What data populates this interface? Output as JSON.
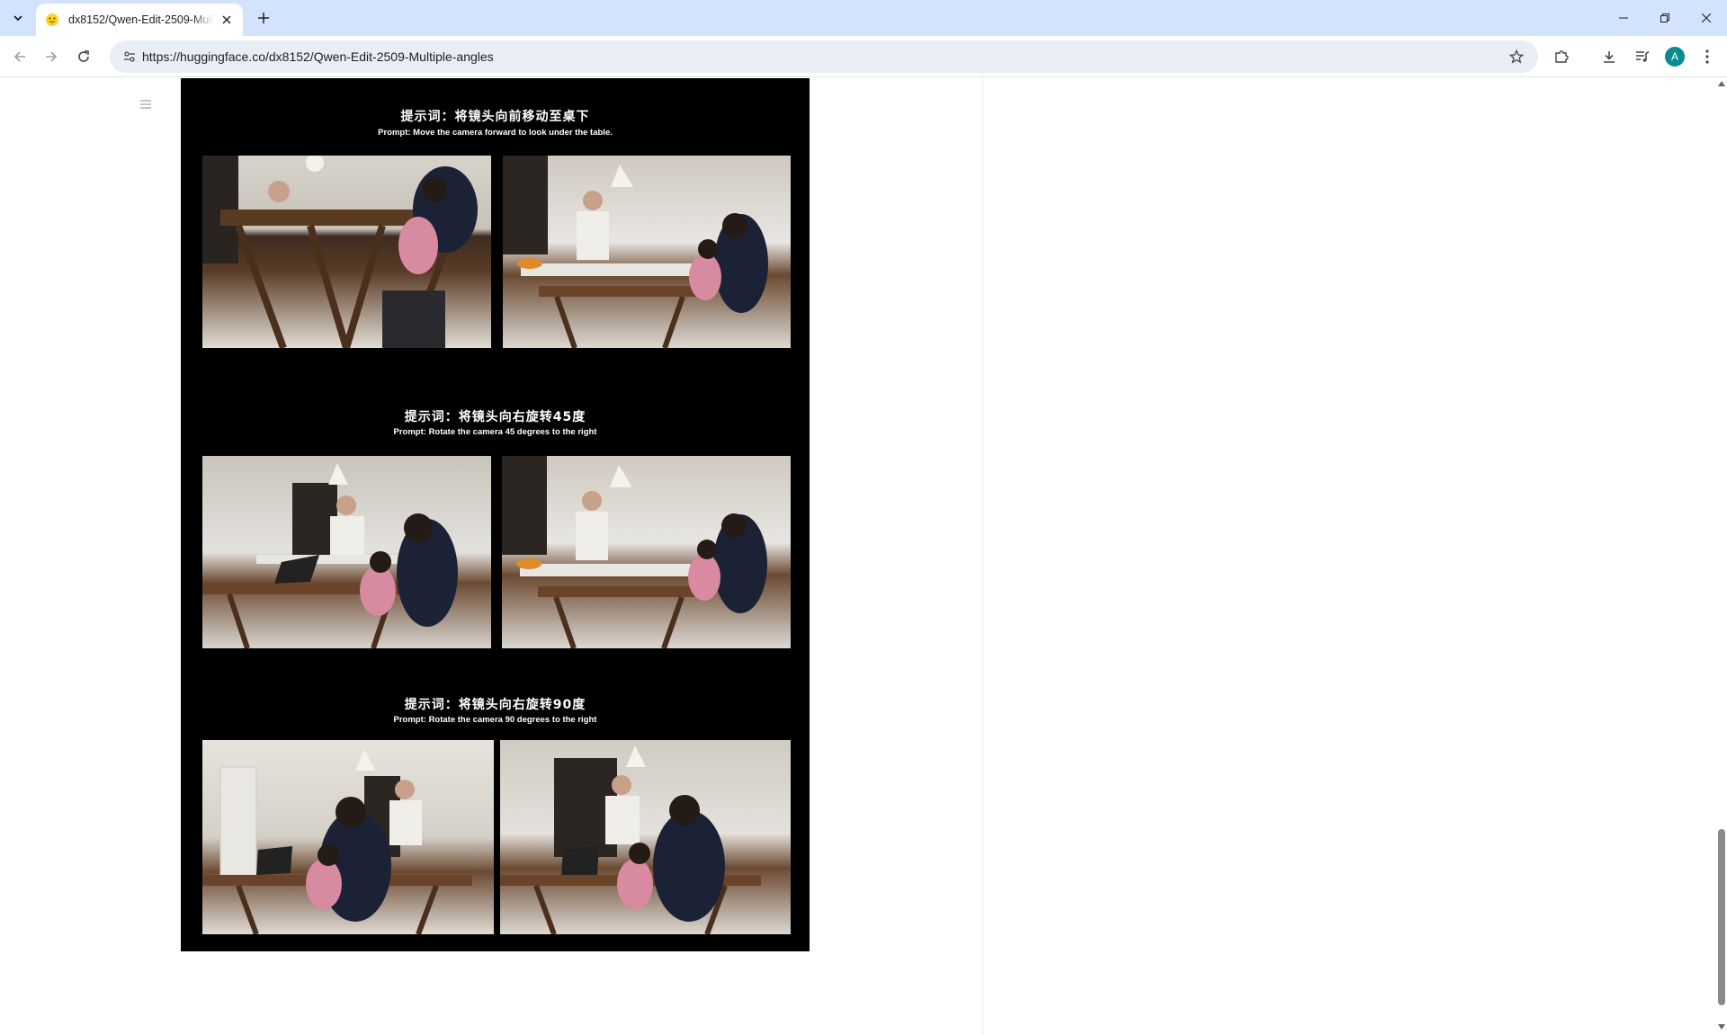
{
  "browser": {
    "tab_title": "dx8152/Qwen-Edit-2509-Multiple-angles",
    "url": "https://huggingface.co/dx8152/Qwen-Edit-2509-Multiple-angles",
    "avatar_letter": "A"
  },
  "figure": {
    "sections": [
      {
        "title_zh": "提示词：将镜头向前移动至桌下",
        "title_en": "Prompt: Move the camera forward to look under the table."
      },
      {
        "title_zh": "提示词：将镜头向右旋转45度",
        "title_en": "Prompt: Rotate the camera 45 degrees to the right"
      },
      {
        "title_zh": "提示词：将镜头向右旋转90度",
        "title_en": "Prompt: Rotate the camera 90 degrees to the right"
      }
    ]
  },
  "colors": {
    "titlebar": "#d3e3fd",
    "omnibox": "#e9eef6",
    "figure_bg": "#000000",
    "avatar": "#0b8a8f"
  }
}
